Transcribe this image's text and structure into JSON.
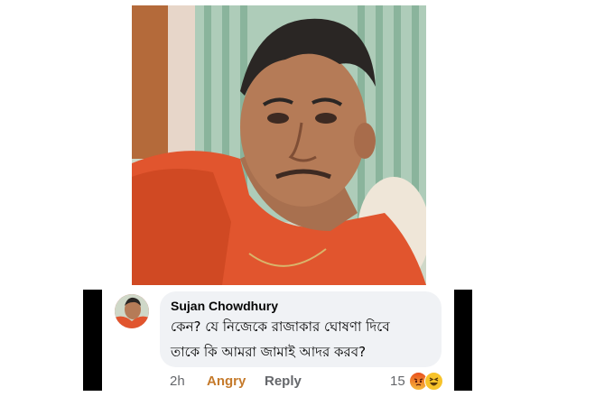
{
  "photo": {
    "description_icon": "profile-photo"
  },
  "comment": {
    "author": "Sujan Chowdhury",
    "text_line1": "কেন? যে নিজেকে রাজাকার ঘোষণা দিবে",
    "text_line2": "তাকে কি আমরা জামাই আদর করব?",
    "time": "2h",
    "reaction_label": "Angry",
    "reply_label": "Reply",
    "reaction_count": "15"
  },
  "colors": {
    "bubble": "#f0f2f5",
    "angry_text": "#c57a2b",
    "muted_text": "#65676b"
  }
}
